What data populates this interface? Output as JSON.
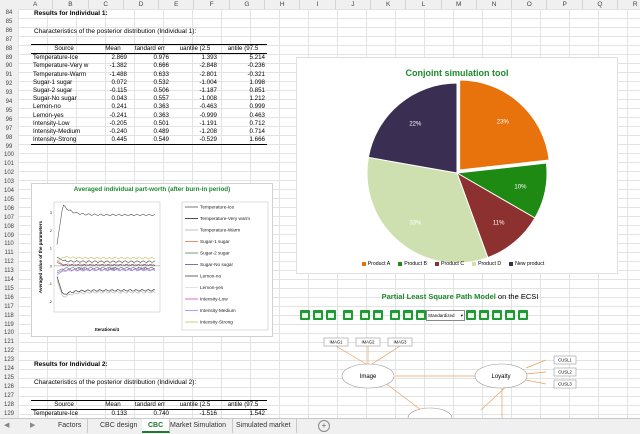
{
  "columns": [
    "A",
    "B",
    "C",
    "D",
    "E",
    "F",
    "G",
    "H",
    "I",
    "J",
    "K",
    "L",
    "M",
    "N",
    "O",
    "P",
    "Q",
    "R"
  ],
  "rows": [
    "84",
    "85",
    "86",
    "87",
    "88",
    "89",
    "90",
    "91",
    "92",
    "93",
    "94",
    "95",
    "96",
    "97",
    "98",
    "99",
    "100",
    "101",
    "102",
    "103",
    "104",
    "105",
    "106",
    "107",
    "108",
    "109",
    "110",
    "111",
    "112",
    "113",
    "114",
    "115",
    "116",
    "117",
    "118",
    "119",
    "120",
    "121",
    "122",
    "123",
    "124",
    "125",
    "126",
    "127",
    "128",
    "129"
  ],
  "section1": {
    "title": "Results for Individual 1:",
    "subtitle": "Characteristics of the posterior distribution (Individual 1):"
  },
  "section2": {
    "title": "Results for Individual 2:",
    "subtitle": "Characteristics of the posterior distribution (Individual 2):"
  },
  "table_headers": [
    "Source",
    "Mean",
    "tandard err",
    "uantile (2.5",
    "antile (97.5"
  ],
  "table1_rows": [
    [
      "Temperature-Ice",
      "2.869",
      "0.976",
      "1.393",
      "5.214"
    ],
    [
      "Temperature-Very w",
      "-1.382",
      "0.666",
      "-2.848",
      "-0.236"
    ],
    [
      "Temperature-Warm",
      "-1.488",
      "0.633",
      "-2.801",
      "-0.321"
    ],
    [
      "Sugar-1 sugar",
      "0.072",
      "0.532",
      "-1.004",
      "1.098"
    ],
    [
      "Sugar-2 sugar",
      "-0.115",
      "0.506",
      "-1.187",
      "0.851"
    ],
    [
      "Sugar-No sugar",
      "0.043",
      "0.557",
      "-1.008",
      "1.212"
    ],
    [
      "Lemon-no",
      "0.241",
      "0.363",
      "-0.463",
      "0.999"
    ],
    [
      "Lemon-yes",
      "-0.241",
      "0.363",
      "-0.999",
      "0.463"
    ],
    [
      "Intensity-Low",
      "-0.205",
      "0.501",
      "-1.191",
      "0.712"
    ],
    [
      "Intensity-Medium",
      "-0.240",
      "0.489",
      "-1.208",
      "0.714"
    ],
    [
      "Intensity-Strong",
      "0.445",
      "0.549",
      "-0.529",
      "1.666"
    ]
  ],
  "table2_rows": [
    [
      "Temperature-Ice",
      "0.133",
      "0.740",
      "-1.516",
      "1.542"
    ]
  ],
  "line_chart": {
    "title": "Averaged individual part-worth (after burn-in period)",
    "ylabel": "Averaged value of the parameters",
    "xlabel": "Iterations/4",
    "xticks": [
      "500",
      "1000",
      "1500"
    ],
    "yticks": [
      "3",
      "2",
      "1",
      "0",
      "-1",
      "-2"
    ],
    "legend": [
      "Temperature-Ice",
      "Temperature-Very warm",
      "Temperature-Warm",
      "Sugar-1 sugar",
      "Sugar-2 sugar",
      "Sugar-No sugar",
      "Lemon-no",
      "Lemon-yes",
      "Intensity-Low",
      "Intensity-Medium",
      "Intensity-Strong"
    ],
    "colors": [
      "#555555",
      "#222222",
      "#b0b0b0",
      "#e07a4a",
      "#4a8c4a",
      "#555599",
      "#444444",
      "#dddddd",
      "#c048c0",
      "#8c8cff",
      "#c0c060"
    ]
  },
  "chart_data": {
    "type": "pie",
    "title": "Conjoint simulation tool",
    "categories": [
      "Product A",
      "Product B",
      "Product C",
      "Product D",
      "New product"
    ],
    "values": [
      23,
      10,
      11,
      33,
      22
    ],
    "labels": [
      "23%",
      "10%",
      "11%",
      "33%",
      "22%"
    ],
    "colors": [
      "#e8720c",
      "#1e8a14",
      "#8c3030",
      "#cfe0b0",
      "#3a2f52"
    ],
    "legend_position": "bottom"
  },
  "pls": {
    "title_bold": "Partial Least Square Path Model",
    "title_rest": "on the ECSI",
    "dropdown": "Standardized",
    "nodes": {
      "image": "Image",
      "loyalty": "Loyalty",
      "imag1": "IMAG1",
      "imag2": "IMAG2",
      "imag3": "IMAG3",
      "cusl1": "CUSL1",
      "cusl2": "CUSL2",
      "cusl3": "CUSL3"
    }
  },
  "tabs": [
    "Factors",
    "CBC design",
    "CBC",
    "Market Simulation",
    "Simulated market"
  ],
  "active_tab": "CBC"
}
